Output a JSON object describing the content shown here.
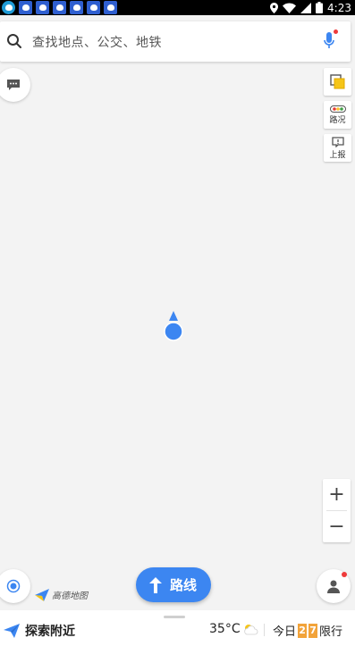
{
  "status_bar": {
    "time": "4:23",
    "app_icons": [
      "app-icon",
      "baidu-paw-icon",
      "baidu-paw-icon",
      "baidu-paw-icon",
      "baidu-paw-icon",
      "baidu-paw-icon",
      "baidu-paw-icon"
    ],
    "system_icons": [
      "location-icon",
      "wifi-icon",
      "signal-icon",
      "battery-icon"
    ]
  },
  "search": {
    "placeholder": "查找地点、公交、地铁",
    "icon": "search-icon",
    "voice_icon": "microphone-icon"
  },
  "tools": {
    "traffic_label": "路况",
    "report_label": "上报"
  },
  "zoom": {
    "in_label": "+",
    "out_label": "−"
  },
  "logo": {
    "text": "高德地图"
  },
  "route": {
    "label": "路线"
  },
  "bottom": {
    "explore_label": "探索附近",
    "temperature": "35°C",
    "today_label": "今日",
    "digit1": "2",
    "digit2": "7",
    "restrict_label": "限行"
  },
  "colors": {
    "accent": "#3c86f1",
    "map_bg": "#f3f3f3",
    "badge_red": "#ef3b3b",
    "digit_orange": "#f2a33a"
  }
}
